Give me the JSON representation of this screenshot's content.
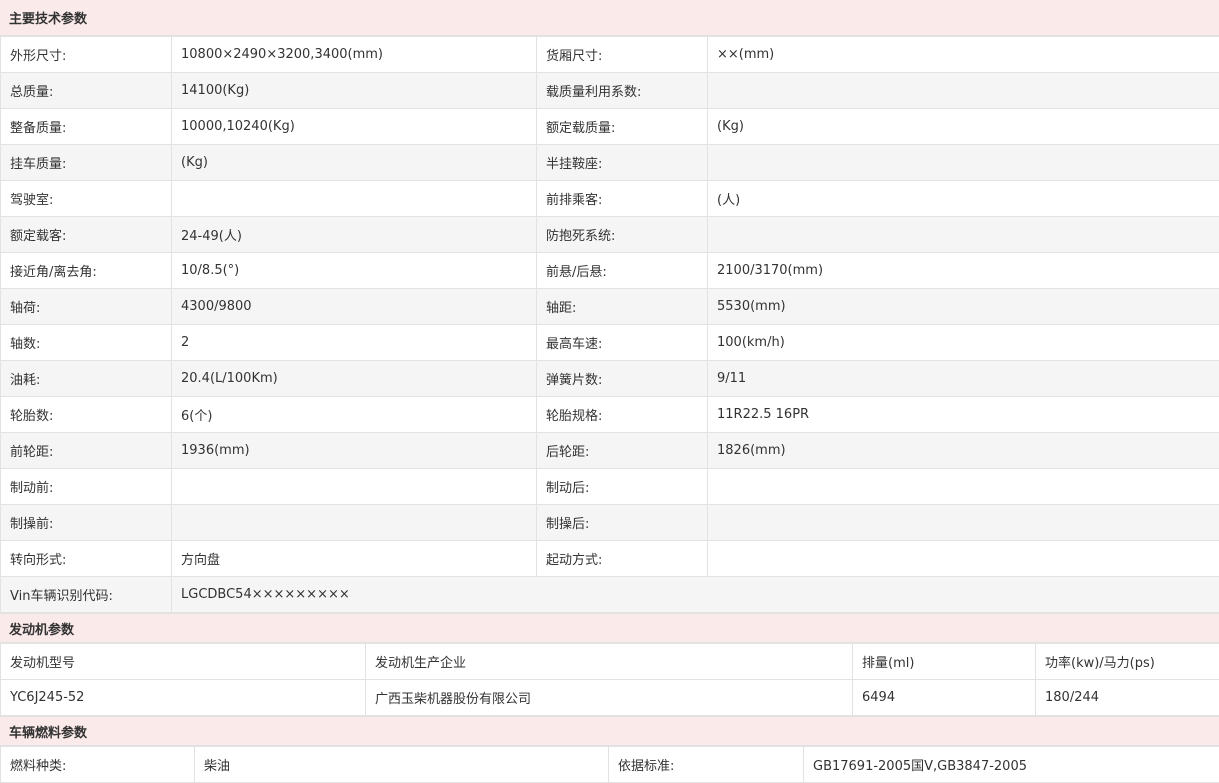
{
  "sections": {
    "tech": "主要技术参数",
    "engine": "发动机参数",
    "fuel": "车辆燃料参数"
  },
  "tech_rows": [
    {
      "l1": "外形尺寸:",
      "v1": "10800×2490×3200,3400(mm)",
      "l2": "货厢尺寸:",
      "v2": "××(mm)"
    },
    {
      "l1": "总质量:",
      "v1": "14100(Kg)",
      "l2": "载质量利用系数:",
      "v2": ""
    },
    {
      "l1": "整备质量:",
      "v1": "10000,10240(Kg)",
      "l2": "额定载质量:",
      "v2": "(Kg)"
    },
    {
      "l1": "挂车质量:",
      "v1": "(Kg)",
      "l2": "半挂鞍座:",
      "v2": ""
    },
    {
      "l1": "驾驶室:",
      "v1": "",
      "l2": "前排乘客:",
      "v2": "(人)"
    },
    {
      "l1": "额定载客:",
      "v1": "24-49(人)",
      "l2": "防抱死系统:",
      "v2": ""
    },
    {
      "l1": "接近角/离去角:",
      "v1": "10/8.5(°)",
      "l2": "前悬/后悬:",
      "v2": "2100/3170(mm)"
    },
    {
      "l1": "轴荷:",
      "v1": "4300/9800",
      "l2": "轴距:",
      "v2": "5530(mm)"
    },
    {
      "l1": "轴数:",
      "v1": "2",
      "l2": "最高车速:",
      "v2": "100(km/h)"
    },
    {
      "l1": "油耗:",
      "v1": "20.4(L/100Km)",
      "l2": "弹簧片数:",
      "v2": "9/11"
    },
    {
      "l1": "轮胎数:",
      "v1": "6(个)",
      "l2": "轮胎规格:",
      "v2": "11R22.5 16PR"
    },
    {
      "l1": "前轮距:",
      "v1": "1936(mm)",
      "l2": "后轮距:",
      "v2": "1826(mm)"
    },
    {
      "l1": "制动前:",
      "v1": "",
      "l2": "制动后:",
      "v2": ""
    },
    {
      "l1": "制操前:",
      "v1": "",
      "l2": "制操后:",
      "v2": ""
    },
    {
      "l1": "转向形式:",
      "v1": "方向盘",
      "l2": "起动方式:",
      "v2": ""
    }
  ],
  "vin": {
    "label": "Vin车辆识别代码:",
    "value": "LGCDBC54×××××××××"
  },
  "engine": {
    "headers": [
      "发动机型号",
      "发动机生产企业",
      "排量(ml)",
      "功率(kw)/马力(ps)"
    ],
    "row": [
      "YC6J245-52",
      "广西玉柴机器股份有限公司",
      "6494",
      "180/244"
    ]
  },
  "fuel": {
    "label1": "燃料种类:",
    "value1": "柴油",
    "label2": "依据标准:",
    "value2": "GB17691-2005国V,GB3847-2005"
  }
}
